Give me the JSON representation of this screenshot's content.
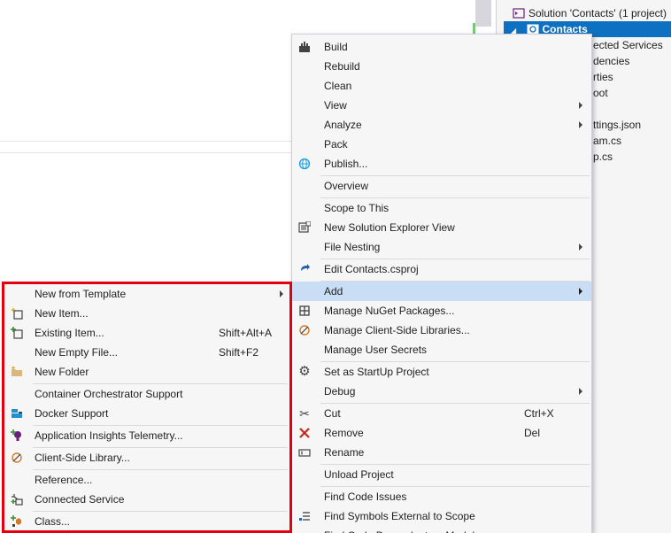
{
  "solution_explorer": {
    "solution_label": "Solution 'Contacts' (1 project)",
    "project_label": "Contacts",
    "items": [
      "ected Services",
      "dencies",
      "rties",
      "oot",
      "ttings.json",
      "am.cs",
      "p.cs"
    ]
  },
  "context_menu": {
    "build": "Build",
    "rebuild": "Rebuild",
    "clean": "Clean",
    "view": "View",
    "analyze": "Analyze",
    "pack": "Pack",
    "publish": "Publish...",
    "overview": "Overview",
    "scope_to_this": "Scope to This",
    "new_solution_explorer_view": "New Solution Explorer View",
    "file_nesting": "File Nesting",
    "edit_project": "Edit Contacts.csproj",
    "add": "Add",
    "manage_nuget": "Manage NuGet Packages...",
    "manage_client_side": "Manage Client-Side Libraries...",
    "manage_user_secrets": "Manage User Secrets",
    "set_startup": "Set as StartUp Project",
    "debug": "Debug",
    "cut": "Cut",
    "cut_shortcut": "Ctrl+X",
    "remove": "Remove",
    "remove_shortcut": "Del",
    "rename": "Rename",
    "unload_project": "Unload Project",
    "find_code_issues": "Find Code Issues",
    "find_symbols_external": "Find Symbols External to Scope",
    "find_code_dependent": "Find Code Dependent on Module"
  },
  "add_submenu": {
    "new_from_template": "New from Template",
    "new_item": "New Item...",
    "existing_item": "Existing Item...",
    "existing_item_shortcut": "Shift+Alt+A",
    "new_empty_file": "New Empty File...",
    "new_empty_file_shortcut": "Shift+F2",
    "new_folder": "New Folder",
    "container_orchestrator": "Container Orchestrator Support",
    "docker_support": "Docker Support",
    "app_insights": "Application Insights Telemetry...",
    "client_side_library": "Client-Side Library...",
    "reference": "Reference...",
    "connected_service": "Connected Service",
    "class": "Class..."
  },
  "colors": {
    "highlight": "#c9def5",
    "annotation_border": "#e3000f",
    "selection": "#0e70c0"
  },
  "icons": [
    "build-icon",
    "publish-globe-icon",
    "new-view-icon",
    "edit-arrow-icon",
    "nuget-icon",
    "client-lib-icon",
    "gear-icon",
    "scissors-icon",
    "remove-x-icon",
    "rename-icon",
    "find-symbols-icon",
    "new-item-icon",
    "existing-item-icon",
    "folder-icon",
    "docker-icon",
    "insights-icon",
    "connected-service-icon",
    "class-icon"
  ]
}
